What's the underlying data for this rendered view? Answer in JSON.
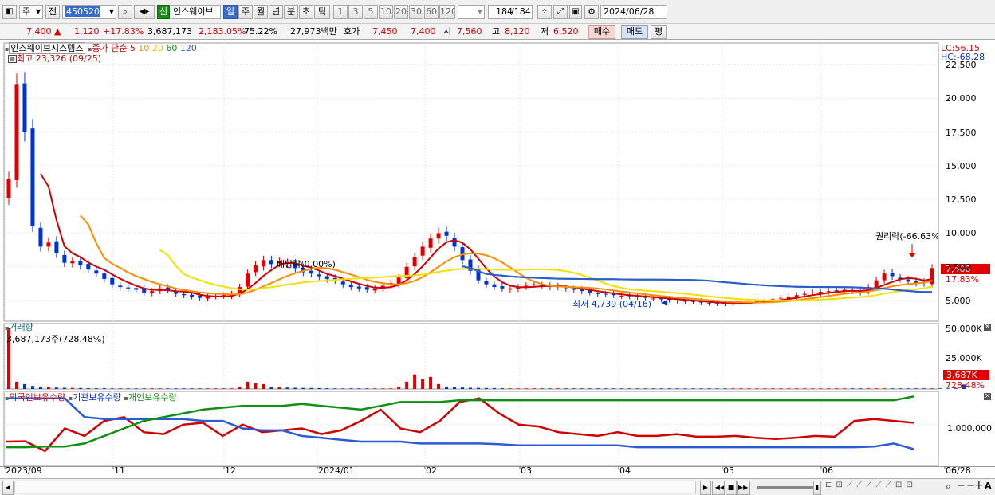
{
  "toolbar": {
    "market": "주",
    "type": "전",
    "code": "450520",
    "credit": "신",
    "stock_name": "인스웨이브",
    "periods": [
      "일",
      "주",
      "월",
      "년",
      "분",
      "초",
      "틱"
    ],
    "active_period": "일",
    "intervals": [
      "1",
      "3",
      "5",
      "10",
      "20",
      "30",
      "60",
      "120"
    ],
    "count": "184",
    "count_total": "/184",
    "date": "2024/06/28"
  },
  "quote": {
    "price": "7,400",
    "arrow": "▲",
    "change": "1,120",
    "change_pct": "+17.83%",
    "volume": "3,687,173",
    "vol_pct": "2,183.05%",
    "turnover": "75.22%",
    "amount": "27,973백만",
    "bid_label": "호가",
    "bid": "7,450",
    "ask": "7,400",
    "open_label": "시",
    "open": "7,560",
    "high_label": "고",
    "high": "8,120",
    "low_label": "저",
    "low": "6,520",
    "buy": "매수",
    "sell": "매도",
    "eval": "평"
  },
  "price_panel": {
    "name": "인스웨이브시스템즈",
    "ma_label": "종가 단순",
    "ma_periods": [
      "5",
      "10",
      "20",
      "60",
      "120"
    ],
    "high_note": "최고 23,326 (09/25)",
    "low_note": "최저 4,739 (04/16)",
    "dividend_note": "배당락(0.00%)",
    "rights_note": "권리락(-66.63%",
    "lc": "LC:56.15",
    "hc": "HC:-68.28",
    "yticks": [
      "22,500",
      "20,000",
      "17,500",
      "15,000",
      "12,500",
      "10,000",
      "7,500",
      "5,000"
    ],
    "cur_price": "7,400",
    "cur_pct": "17.83%"
  },
  "volume_panel": {
    "title": "거래량",
    "info": "3,687,173주(728.48%)",
    "yticks": [
      "50,000K",
      "25,000K"
    ],
    "cur": "3,687K",
    "cur_pct": "728.48%"
  },
  "holding_panel": {
    "series": [
      "외국인보유수량",
      "기관보유수량",
      "개인보유수량"
    ],
    "ytick": "1,000,000"
  },
  "xaxis": [
    "2023/09",
    "11",
    "12",
    "2024/01",
    "02",
    "03",
    "04",
    "05",
    "06",
    "06/28"
  ],
  "colors": {
    "up": "#e00000",
    "down": "#0033cc",
    "ma5": "#d00000",
    "ma10": "#ff8c00",
    "ma20": "#f5e000",
    "ma60": "#109010",
    "ma120": "#2b5bd7"
  },
  "chart_data": {
    "type": "candlestick",
    "close": [
      14000,
      21000,
      17500,
      10500,
      9000,
      9300,
      8500,
      7800,
      7900,
      7600,
      7300,
      7000,
      6600,
      6200,
      6000,
      5900,
      5800,
      5600,
      5700,
      5900,
      5800,
      5500,
      5400,
      5300,
      5200,
      5300,
      5300,
      5400,
      5500,
      6000,
      7000,
      7600,
      8000,
      7700,
      7900,
      7800,
      7400,
      7100,
      7000,
      6800,
      6600,
      6500,
      6200,
      6000,
      5900,
      5800,
      5900,
      6100,
      6300,
      6700,
      7500,
      8200,
      9000,
      9600,
      10000,
      9800,
      9000,
      8000,
      7200,
      6500,
      6200,
      6000,
      5900,
      5900,
      6000,
      6100,
      6200,
      6100,
      6000,
      6000,
      5900,
      5800,
      5700,
      5600,
      5500,
      5450,
      5400,
      5350,
      5300,
      5250,
      5200,
      5150,
      5100,
      5050,
      5000,
      4950,
      4900,
      4850,
      4800,
      4780,
      4760,
      4800,
      4850,
      4900,
      4950,
      5000,
      5100,
      5200,
      5300,
      5400,
      5500,
      5600,
      5650,
      5700,
      5750,
      5800,
      5700,
      5600,
      6000,
      6500,
      7000,
      6800,
      6600,
      6400,
      6300,
      6280,
      7400
    ],
    "volume_k": [
      50000,
      6000,
      4000,
      2500,
      2000,
      1500,
      1200,
      1000,
      900,
      800,
      700,
      600,
      600,
      500,
      500,
      500,
      500,
      500,
      500,
      500,
      500,
      500,
      500,
      500,
      500,
      500,
      500,
      500,
      500,
      2000,
      6000,
      5000,
      4000,
      2000,
      1500,
      1200,
      1000,
      900,
      800,
      700,
      600,
      500,
      500,
      500,
      500,
      500,
      500,
      500,
      500,
      2000,
      6000,
      12000,
      8000,
      10000,
      4000,
      2000,
      1500,
      1200,
      1000,
      900,
      800,
      700,
      600,
      500,
      500,
      500,
      500,
      500,
      500,
      500,
      500,
      500,
      500,
      500,
      500,
      500,
      500,
      500,
      500,
      500,
      500,
      500,
      500,
      500,
      500,
      500,
      500,
      500,
      500,
      500,
      500,
      500,
      500,
      500,
      500,
      500,
      500,
      500,
      500,
      500,
      500,
      500,
      500,
      500,
      500,
      500,
      500,
      500,
      500,
      500,
      500,
      500,
      500,
      500,
      500,
      500,
      500,
      500,
      500,
      500,
      3687
    ],
    "holdings": {
      "foreign": [
        550000,
        560000,
        300000,
        900000,
        700000,
        1100000,
        1200000,
        800000,
        750000,
        1000000,
        1050000,
        700000,
        1000000,
        800000,
        850000,
        900000,
        750000,
        850000,
        1100000,
        1400000,
        900000,
        800000,
        1100000,
        1600000,
        1700000,
        1300000,
        1000000,
        950000,
        800000,
        750000,
        700000,
        800000,
        700000,
        700000,
        750000,
        680000,
        680000,
        700000,
        650000,
        620000,
        650000,
        700000,
        680000,
        1100000,
        1150000,
        1100000,
        1050000
      ],
      "institution": [
        1700000,
        1700000,
        1700000,
        1700000,
        1200000,
        1150000,
        1150000,
        1150000,
        1150000,
        1150000,
        1100000,
        1100000,
        900000,
        850000,
        850000,
        700000,
        650000,
        600000,
        550000,
        550000,
        550000,
        500000,
        500000,
        500000,
        500000,
        480000,
        450000,
        450000,
        450000,
        450000,
        450000,
        450000,
        400000,
        400000,
        400000,
        400000,
        400000,
        400000,
        400000,
        400000,
        400000,
        400000,
        400000,
        400000,
        420000,
        500000,
        350000
      ],
      "individual": [
        400000,
        400000,
        420000,
        420000,
        500000,
        700000,
        900000,
        1100000,
        1200000,
        1300000,
        1400000,
        1450000,
        1500000,
        1500000,
        1500000,
        1550000,
        1500000,
        1450000,
        1400000,
        1500000,
        1600000,
        1600000,
        1600000,
        1650000,
        1650000,
        1650000,
        1650000,
        1650000,
        1650000,
        1650000,
        1650000,
        1650000,
        1650000,
        1650000,
        1650000,
        1650000,
        1650000,
        1650000,
        1650000,
        1650000,
        1650000,
        1650000,
        1650000,
        1650000,
        1650000,
        1650000,
        1750000
      ]
    }
  }
}
